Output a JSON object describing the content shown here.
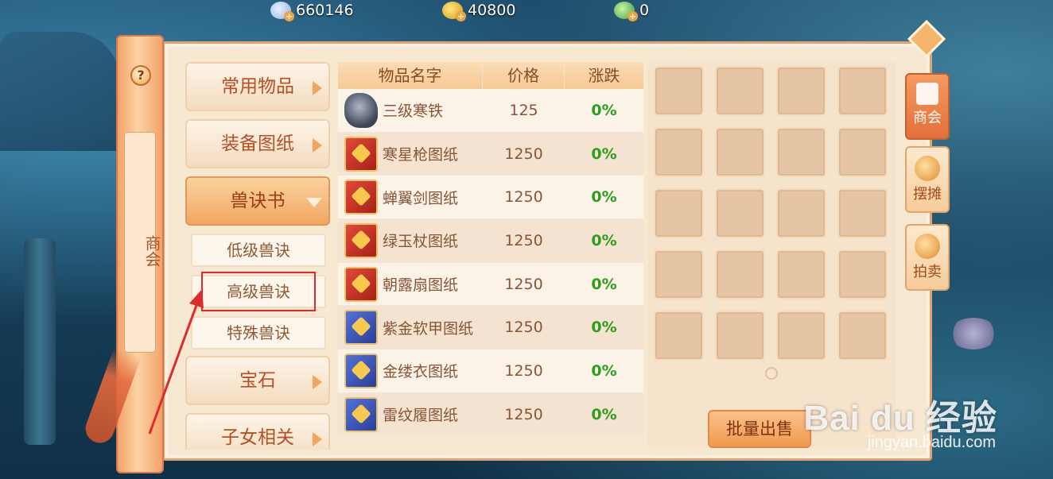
{
  "currency": {
    "silver": "660146",
    "gold": "40800",
    "jade": "0"
  },
  "banner": {
    "help": "?",
    "title": "商会"
  },
  "categories": [
    {
      "label": "常用物品"
    },
    {
      "label": "装备图纸"
    },
    {
      "label": "兽诀书"
    },
    {
      "label": "宝石"
    },
    {
      "label": "子女相关"
    }
  ],
  "subcategories": [
    {
      "label": "低级兽诀"
    },
    {
      "label": "高级兽诀"
    },
    {
      "label": "特殊兽诀"
    }
  ],
  "table": {
    "headers": [
      "物品名字",
      "价格",
      "涨跌"
    ],
    "rows": [
      {
        "name": "三级寒铁",
        "price": "125",
        "change": "0%",
        "icon": "ore-icon"
      },
      {
        "name": "寒星枪图纸",
        "price": "1250",
        "change": "0%",
        "icon": "red-blueprint-icon"
      },
      {
        "name": "蝉翼剑图纸",
        "price": "1250",
        "change": "0%",
        "icon": "red-blueprint-icon"
      },
      {
        "name": "绿玉杖图纸",
        "price": "1250",
        "change": "0%",
        "icon": "red-blueprint-icon"
      },
      {
        "name": "朝露扇图纸",
        "price": "1250",
        "change": "0%",
        "icon": "red-blueprint-icon"
      },
      {
        "name": "紫金软甲图纸",
        "price": "1250",
        "change": "0%",
        "icon": "blue-blueprint-icon"
      },
      {
        "name": "金缕衣图纸",
        "price": "1250",
        "change": "0%",
        "icon": "blue-blueprint-icon"
      },
      {
        "name": "雷纹履图纸",
        "price": "1250",
        "change": "0%",
        "icon": "blue-blueprint-icon"
      }
    ]
  },
  "inventory": {
    "bulk_sell": "批量出售"
  },
  "side_tabs": [
    {
      "label": "商会",
      "icon": "merchant-icon"
    },
    {
      "label": "摆摊",
      "icon": "stall-icon"
    },
    {
      "label": "拍卖",
      "icon": "auction-icon"
    }
  ],
  "watermark": {
    "brand": "Bai du 经验",
    "url": "jingyan.baidu.com"
  },
  "colors": {
    "price_change": "#2c9d1c",
    "highlight": "#e02a2a",
    "active_tab": "#e3703a"
  }
}
